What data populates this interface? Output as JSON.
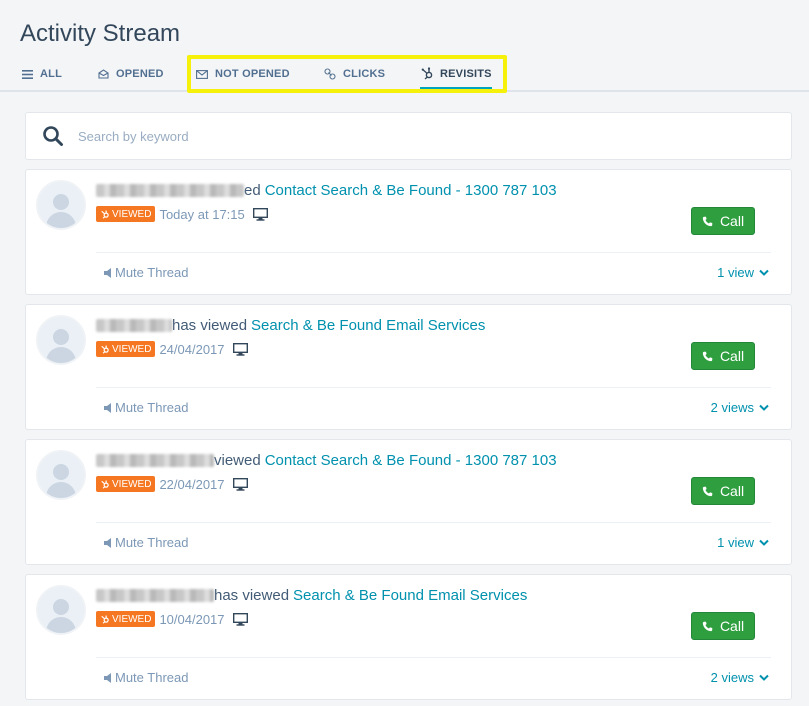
{
  "page": {
    "title": "Activity Stream"
  },
  "tabs": [
    {
      "label": "ALL",
      "icon": "list-icon"
    },
    {
      "label": "OPENED",
      "icon": "envelope-open-icon"
    },
    {
      "label": "NOT OPENED",
      "icon": "envelope-icon"
    },
    {
      "label": "CLICKS",
      "icon": "link-icon"
    },
    {
      "label": "REVISITS",
      "icon": "hubspot-sprocket-icon",
      "active": true
    }
  ],
  "search": {
    "placeholder": "Search by keyword"
  },
  "activities": [
    {
      "verb": "ed",
      "link": "Contact Search & Be Found - 1300 787 103",
      "badge": "VIEWED",
      "time": "Today at 17:15",
      "call_label": "Call",
      "mute_label": "Mute Thread",
      "views_label": "1 view"
    },
    {
      "verb": "has viewed",
      "link": "Search & Be Found Email Services",
      "badge": "VIEWED",
      "time": "24/04/2017",
      "call_label": "Call",
      "mute_label": "Mute Thread",
      "views_label": "2 views"
    },
    {
      "verb": "viewed",
      "link": "Contact Search & Be Found - 1300 787 103",
      "badge": "VIEWED",
      "time": "22/04/2017",
      "call_label": "Call",
      "mute_label": "Mute Thread",
      "views_label": "1 view"
    },
    {
      "verb": "has viewed",
      "link": "Search & Be Found Email Services",
      "badge": "VIEWED",
      "time": "10/04/2017",
      "call_label": "Call",
      "mute_label": "Mute Thread",
      "views_label": "2 views"
    }
  ],
  "colors": {
    "accent": "#0091ae",
    "tab_active_underline": "#00a4bd",
    "badge_orange": "#f57722",
    "call_green": "#2e9e3f",
    "highlight_yellow": "#f5f10a"
  }
}
